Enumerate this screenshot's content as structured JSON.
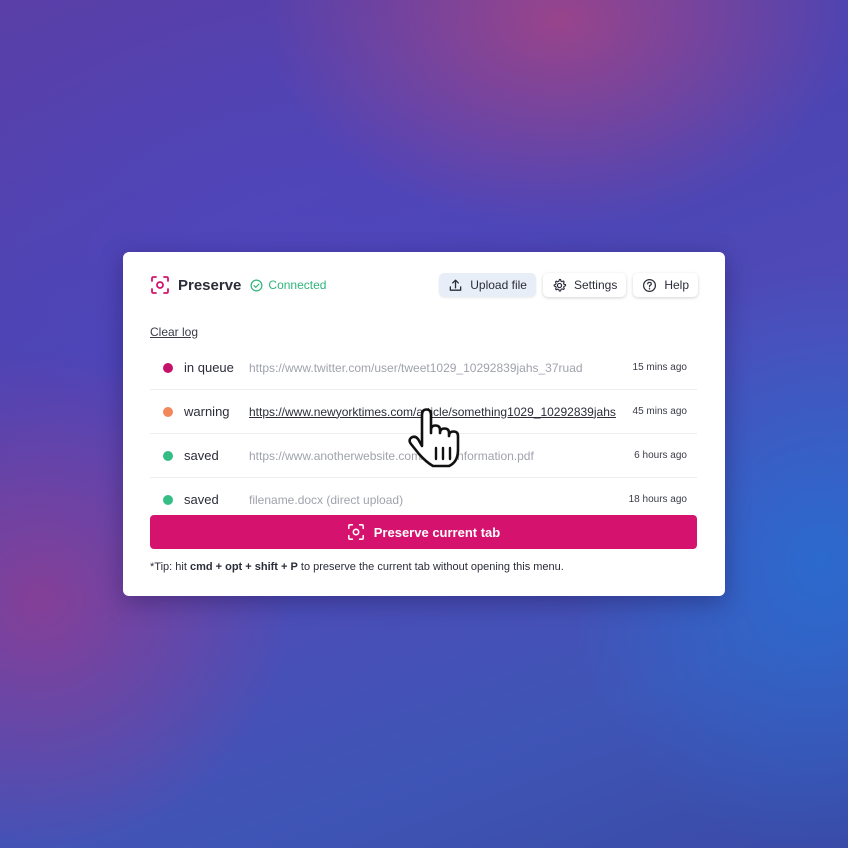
{
  "header": {
    "title": "Preserve",
    "connection_status": "Connected",
    "upload_label": "Upload file",
    "settings_label": "Settings",
    "help_label": "Help"
  },
  "clear_log_label": "Clear log",
  "log": [
    {
      "status": "in queue",
      "color": "#c4126b",
      "url": "https://www.twitter.com/user/tweet1029_10292839jahs_37ruad",
      "time": "15 mins ago",
      "is_link": false
    },
    {
      "status": "warning",
      "color": "#f2885a",
      "url": "https://www.newyorktimes.com/article/something1029_10292839jahs",
      "time": "45 mins ago",
      "is_link": true
    },
    {
      "status": "saved",
      "color": "#35bd86",
      "url": "https://www.anotherwebsite.com/page/information.pdf",
      "time": "6 hours ago",
      "is_link": false
    },
    {
      "status": "saved",
      "color": "#35bd86",
      "url": "filename.docx (direct upload)",
      "time": "18 hours ago",
      "is_link": false
    }
  ],
  "preserve_button_label": "Preserve current tab",
  "tip": {
    "prefix": "*Tip: hit ",
    "shortcut": "cmd + opt + shift + P",
    "suffix": " to preserve the current tab without opening this menu."
  },
  "colors": {
    "accent": "#d5136e",
    "connected": "#2fb57a",
    "upload_button_bg": "#e8eef8"
  },
  "icons": {
    "brand": "camera-focus-icon",
    "connected": "check-circle-icon",
    "upload": "upload-icon",
    "settings": "gear-icon",
    "help": "help-icon",
    "cursor": "hand-pointer-cursor"
  }
}
